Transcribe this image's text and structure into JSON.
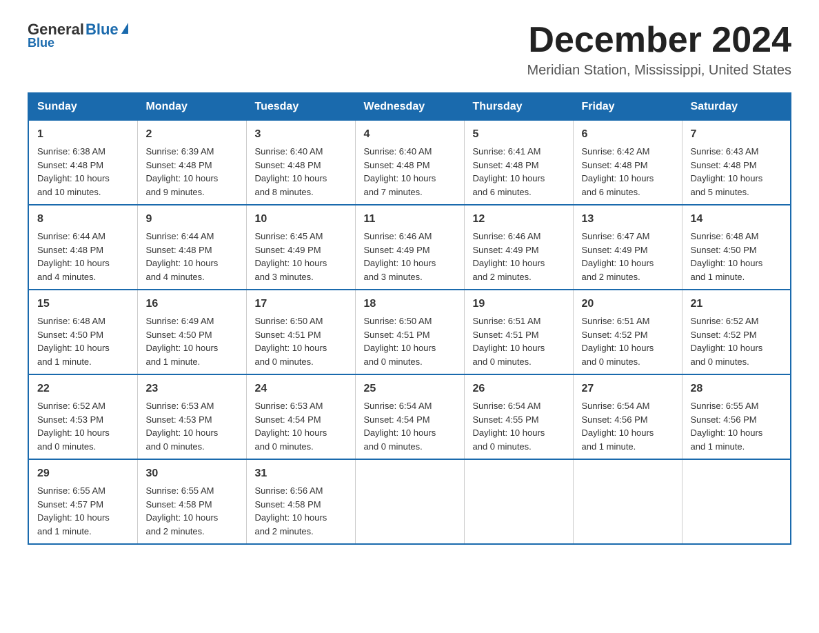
{
  "header": {
    "logo_general": "General",
    "logo_blue": "Blue",
    "month_title": "December 2024",
    "location": "Meridian Station, Mississippi, United States"
  },
  "days_of_week": [
    "Sunday",
    "Monday",
    "Tuesday",
    "Wednesday",
    "Thursday",
    "Friday",
    "Saturday"
  ],
  "weeks": [
    [
      {
        "day": "1",
        "sunrise": "6:38 AM",
        "sunset": "4:48 PM",
        "daylight": "10 hours and 10 minutes."
      },
      {
        "day": "2",
        "sunrise": "6:39 AM",
        "sunset": "4:48 PM",
        "daylight": "10 hours and 9 minutes."
      },
      {
        "day": "3",
        "sunrise": "6:40 AM",
        "sunset": "4:48 PM",
        "daylight": "10 hours and 8 minutes."
      },
      {
        "day": "4",
        "sunrise": "6:40 AM",
        "sunset": "4:48 PM",
        "daylight": "10 hours and 7 minutes."
      },
      {
        "day": "5",
        "sunrise": "6:41 AM",
        "sunset": "4:48 PM",
        "daylight": "10 hours and 6 minutes."
      },
      {
        "day": "6",
        "sunrise": "6:42 AM",
        "sunset": "4:48 PM",
        "daylight": "10 hours and 6 minutes."
      },
      {
        "day": "7",
        "sunrise": "6:43 AM",
        "sunset": "4:48 PM",
        "daylight": "10 hours and 5 minutes."
      }
    ],
    [
      {
        "day": "8",
        "sunrise": "6:44 AM",
        "sunset": "4:48 PM",
        "daylight": "10 hours and 4 minutes."
      },
      {
        "day": "9",
        "sunrise": "6:44 AM",
        "sunset": "4:48 PM",
        "daylight": "10 hours and 4 minutes."
      },
      {
        "day": "10",
        "sunrise": "6:45 AM",
        "sunset": "4:49 PM",
        "daylight": "10 hours and 3 minutes."
      },
      {
        "day": "11",
        "sunrise": "6:46 AM",
        "sunset": "4:49 PM",
        "daylight": "10 hours and 3 minutes."
      },
      {
        "day": "12",
        "sunrise": "6:46 AM",
        "sunset": "4:49 PM",
        "daylight": "10 hours and 2 minutes."
      },
      {
        "day": "13",
        "sunrise": "6:47 AM",
        "sunset": "4:49 PM",
        "daylight": "10 hours and 2 minutes."
      },
      {
        "day": "14",
        "sunrise": "6:48 AM",
        "sunset": "4:50 PM",
        "daylight": "10 hours and 1 minute."
      }
    ],
    [
      {
        "day": "15",
        "sunrise": "6:48 AM",
        "sunset": "4:50 PM",
        "daylight": "10 hours and 1 minute."
      },
      {
        "day": "16",
        "sunrise": "6:49 AM",
        "sunset": "4:50 PM",
        "daylight": "10 hours and 1 minute."
      },
      {
        "day": "17",
        "sunrise": "6:50 AM",
        "sunset": "4:51 PM",
        "daylight": "10 hours and 0 minutes."
      },
      {
        "day": "18",
        "sunrise": "6:50 AM",
        "sunset": "4:51 PM",
        "daylight": "10 hours and 0 minutes."
      },
      {
        "day": "19",
        "sunrise": "6:51 AM",
        "sunset": "4:51 PM",
        "daylight": "10 hours and 0 minutes."
      },
      {
        "day": "20",
        "sunrise": "6:51 AM",
        "sunset": "4:52 PM",
        "daylight": "10 hours and 0 minutes."
      },
      {
        "day": "21",
        "sunrise": "6:52 AM",
        "sunset": "4:52 PM",
        "daylight": "10 hours and 0 minutes."
      }
    ],
    [
      {
        "day": "22",
        "sunrise": "6:52 AM",
        "sunset": "4:53 PM",
        "daylight": "10 hours and 0 minutes."
      },
      {
        "day": "23",
        "sunrise": "6:53 AM",
        "sunset": "4:53 PM",
        "daylight": "10 hours and 0 minutes."
      },
      {
        "day": "24",
        "sunrise": "6:53 AM",
        "sunset": "4:54 PM",
        "daylight": "10 hours and 0 minutes."
      },
      {
        "day": "25",
        "sunrise": "6:54 AM",
        "sunset": "4:54 PM",
        "daylight": "10 hours and 0 minutes."
      },
      {
        "day": "26",
        "sunrise": "6:54 AM",
        "sunset": "4:55 PM",
        "daylight": "10 hours and 0 minutes."
      },
      {
        "day": "27",
        "sunrise": "6:54 AM",
        "sunset": "4:56 PM",
        "daylight": "10 hours and 1 minute."
      },
      {
        "day": "28",
        "sunrise": "6:55 AM",
        "sunset": "4:56 PM",
        "daylight": "10 hours and 1 minute."
      }
    ],
    [
      {
        "day": "29",
        "sunrise": "6:55 AM",
        "sunset": "4:57 PM",
        "daylight": "10 hours and 1 minute."
      },
      {
        "day": "30",
        "sunrise": "6:55 AM",
        "sunset": "4:58 PM",
        "daylight": "10 hours and 2 minutes."
      },
      {
        "day": "31",
        "sunrise": "6:56 AM",
        "sunset": "4:58 PM",
        "daylight": "10 hours and 2 minutes."
      },
      null,
      null,
      null,
      null
    ]
  ],
  "labels": {
    "sunrise": "Sunrise:",
    "sunset": "Sunset:",
    "daylight": "Daylight:"
  }
}
